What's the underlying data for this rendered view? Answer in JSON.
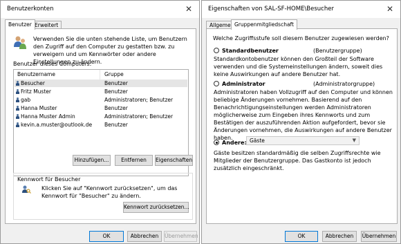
{
  "left_window": {
    "title": "Benutzerkonten",
    "close_glyph": "✕",
    "tabs": [
      "Benutzer",
      "Erweitert"
    ],
    "intro": "Verwenden Sie die unten stehende Liste, um Benutzern den Zugriff auf den Computer zu gestatten bzw. zu verweigern und um Kennwörter oder andere Einstellungen zu ändern.",
    "users_label": "Benutzer dieses Computers:",
    "columns": [
      "Benutzername",
      "Gruppe"
    ],
    "users": [
      {
        "name": "Besucher",
        "group": "Benutzer"
      },
      {
        "name": "Fritz Muster",
        "group": "Benutzer"
      },
      {
        "name": "gab",
        "group": "Administratoren; Benutzer"
      },
      {
        "name": "Hanna Muster",
        "group": "Benutzer"
      },
      {
        "name": "Hanna Muster Admin",
        "group": "Administratoren; Benutzer"
      },
      {
        "name": "kevin.a.muster@outlook.de",
        "group": "Benutzer"
      }
    ],
    "buttons": {
      "add": "Hinzufügen...",
      "remove": "Entfernen",
      "properties": "Eigenschaften"
    },
    "password_group_title": "Kennwort für Besucher",
    "password_text": "Klicken Sie auf \"Kennwort zurücksetzen\", um das Kennwort für \"Besucher\" zu ändern.",
    "reset_button": "Kennwort zurücksetzen...",
    "ok": "OK",
    "cancel": "Abbrechen",
    "apply": "Übernehmen"
  },
  "right_window": {
    "title": "Eigenschaften von SAL-SF-HOME\\Besucher",
    "close_glyph": "✕",
    "tabs": [
      "Allgemein",
      "Gruppenmitgliedschaft"
    ],
    "question": "Welche Zugriffsstufe soll diesem Benutzer zugewiesen werden?",
    "options": [
      {
        "label": "Standardbenutzer",
        "group": "(Benutzergruppe)",
        "selected": false,
        "description": "Standardkontobenutzer können den Großteil der Software verwenden und die Systemeinstellungen ändern, soweit dies keine Auswirkungen auf andere Benutzer hat."
      },
      {
        "label": "Administrator",
        "group": "(Administratorgruppe)",
        "selected": false,
        "description": "Administratoren haben Vollzugriff auf den Computer und können beliebige Änderungen vornehmen. Basierend auf den Benachrichtigungseinstellungen werden Administratoren möglicherweise zum Eingeben ihres Kennworts und zum Bestätigen der auszuführenden Aktion aufgefordert, bevor sie Änderungen vornehmen, die Auswirkungen auf andere Benutzer haben."
      },
      {
        "label": "Andere:",
        "selected": true,
        "value": "Gäste",
        "description": "Gäste besitzen standardmäßig die selben Zugriffsrechte wie Mitglieder der Benutzergruppe. Das Gastkonto ist jedoch zusätzlich eingeschränkt."
      }
    ],
    "ok": "OK",
    "cancel": "Abbrechen",
    "apply": "Übernehmen"
  }
}
